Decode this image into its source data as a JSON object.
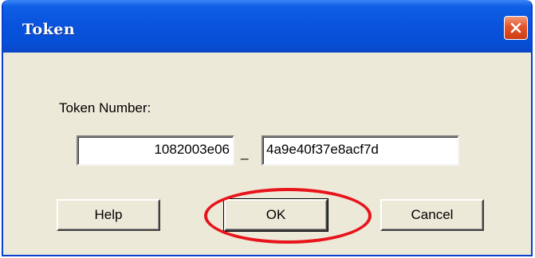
{
  "window": {
    "title": "Token"
  },
  "form": {
    "token_label": "Token Number:",
    "token_part1": "1082003e06",
    "separator": "_",
    "token_part2": "4a9e40f37e8acf7d"
  },
  "buttons": {
    "help": "Help",
    "ok": "OK",
    "cancel": "Cancel"
  },
  "annotation": {
    "highlight_color": "#e8141c"
  }
}
